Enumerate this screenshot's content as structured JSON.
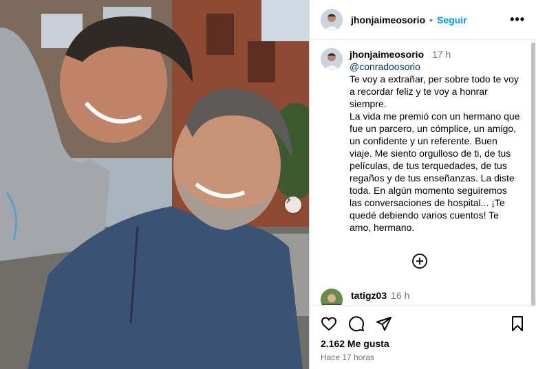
{
  "post": {
    "author": "jhonjaimeosorio",
    "separator": "•",
    "follow_label": "Seguir",
    "more_label": "•••"
  },
  "caption": {
    "user": "jhonjaimeosorio",
    "time": "17 h",
    "mention": "@conradoosorio",
    "text": "Te voy a extrañar, per sobre todo te voy a recordar feliz y te voy a honrar siempre.\nLa vida me premió con un hermano que fue un parcero, un cómplice, un amigo, un confidente y un referente. Buen viaje. Me siento orgulloso de ti, de tus películas, de tus terquedades, de tus regaños y de tus enseñanzas. La diste toda. En algún momento seguiremos las conversaciones de hospital... ¡Te quedé debiendo varios cuentos! Te amo, hermano."
  },
  "comment": {
    "user": "tatigz03",
    "time": "16 h"
  },
  "actions": {
    "likes": "2.162 Me gusta",
    "time_ago": "Hace 17 horas"
  },
  "icons": {
    "like": "heart-icon",
    "comment": "comment-icon",
    "share": "share-icon",
    "save": "bookmark-icon",
    "add": "plus-circle-icon",
    "next": "chevron-right-icon"
  },
  "colors": {
    "link": "#0095f6",
    "mention": "#00376b",
    "secondary": "#737373"
  }
}
